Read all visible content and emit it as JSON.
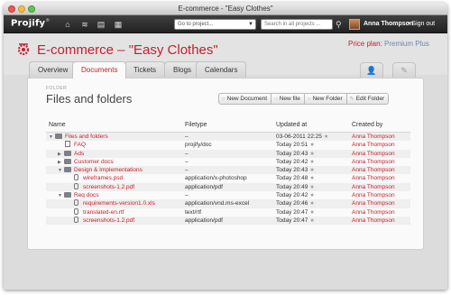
{
  "window": {
    "title": "E-commerce - \"Easy Clothes\""
  },
  "appbar": {
    "logo": "Projify",
    "goto_placeholder": "Go to project...",
    "search_placeholder": "Search in all projects ...",
    "user_name": "Anna Thompson",
    "signout_label": "• Sign out"
  },
  "project": {
    "title": "E-commerce – \"Easy Clothes\"",
    "plan_label": "Price plan:",
    "plan_value": "Premium Plus"
  },
  "tabs": [
    "Overview",
    "Documents",
    "Tickets",
    "Blogs",
    "Calendars"
  ],
  "active_tab": "Documents",
  "folder": {
    "label": "FOLDER",
    "title": "Files and folders"
  },
  "toolbar": {
    "new_document": "New Document",
    "new_file": "New file",
    "new_folder": "New Folder",
    "edit_folder": "Edit Folder"
  },
  "table": {
    "columns": [
      "Name",
      "Filetype",
      "Updated at",
      "Created by"
    ],
    "rows": [
      {
        "name": "Files and folders",
        "type": "–",
        "updated": "03-06-2011 22:25",
        "creator": "Anna Thompson",
        "level": 0,
        "kind": "folder",
        "expanded": true
      },
      {
        "name": "FAQ",
        "type": "projify/doc",
        "updated": "Today 20:51",
        "creator": "Anna Thompson",
        "level": 1,
        "kind": "doc"
      },
      {
        "name": "Ads",
        "type": "–",
        "updated": "Today 20:43",
        "creator": "Anna Thompson",
        "level": 1,
        "kind": "folder",
        "expanded": false
      },
      {
        "name": "Customer docs",
        "type": "–",
        "updated": "Today 20:42",
        "creator": "Anna Thompson",
        "level": 1,
        "kind": "folder",
        "expanded": false
      },
      {
        "name": "Design & Implementations",
        "type": "–",
        "updated": "Today 20:43",
        "creator": "Anna Thompson",
        "level": 1,
        "kind": "folder",
        "expanded": true
      },
      {
        "name": "wireframes.psd",
        "type": "application/x-photoshop",
        "updated": "Today 20:48",
        "creator": "Anna Thompson",
        "level": 2,
        "kind": "file"
      },
      {
        "name": "screenshots-1.2.pdf",
        "type": "application/pdf",
        "updated": "Today 20:49",
        "creator": "Anna Thompson",
        "level": 2,
        "kind": "file"
      },
      {
        "name": "Req docs",
        "type": "–",
        "updated": "Today 20:42",
        "creator": "Anna Thompson",
        "level": 1,
        "kind": "folder",
        "expanded": true
      },
      {
        "name": "requirements-version1.0.xls",
        "type": "application/vnd.ms-excel",
        "updated": "Today 20:46",
        "creator": "Anna Thompson",
        "level": 2,
        "kind": "file"
      },
      {
        "name": "translated-en.rtf",
        "type": "text/rtf",
        "updated": "Today 20:47",
        "creator": "Anna Thompson",
        "level": 2,
        "kind": "file"
      },
      {
        "name": "screenshots-1.2.pdf",
        "type": "application/pdf",
        "updated": "Today 20:47",
        "creator": "Anna Thompson",
        "level": 2,
        "kind": "file"
      }
    ]
  },
  "colors": {
    "accent": "#c4202c",
    "appbar": "#2e2e2e",
    "plan_value": "#6f86a4"
  },
  "icons": [
    "home-icon",
    "signal-icon",
    "document-icon",
    "calendar-icon",
    "search-icon",
    "user-tab-icon",
    "edit-tab-icon",
    "star-icon",
    "folder-icon",
    "paperclip-icon"
  ]
}
